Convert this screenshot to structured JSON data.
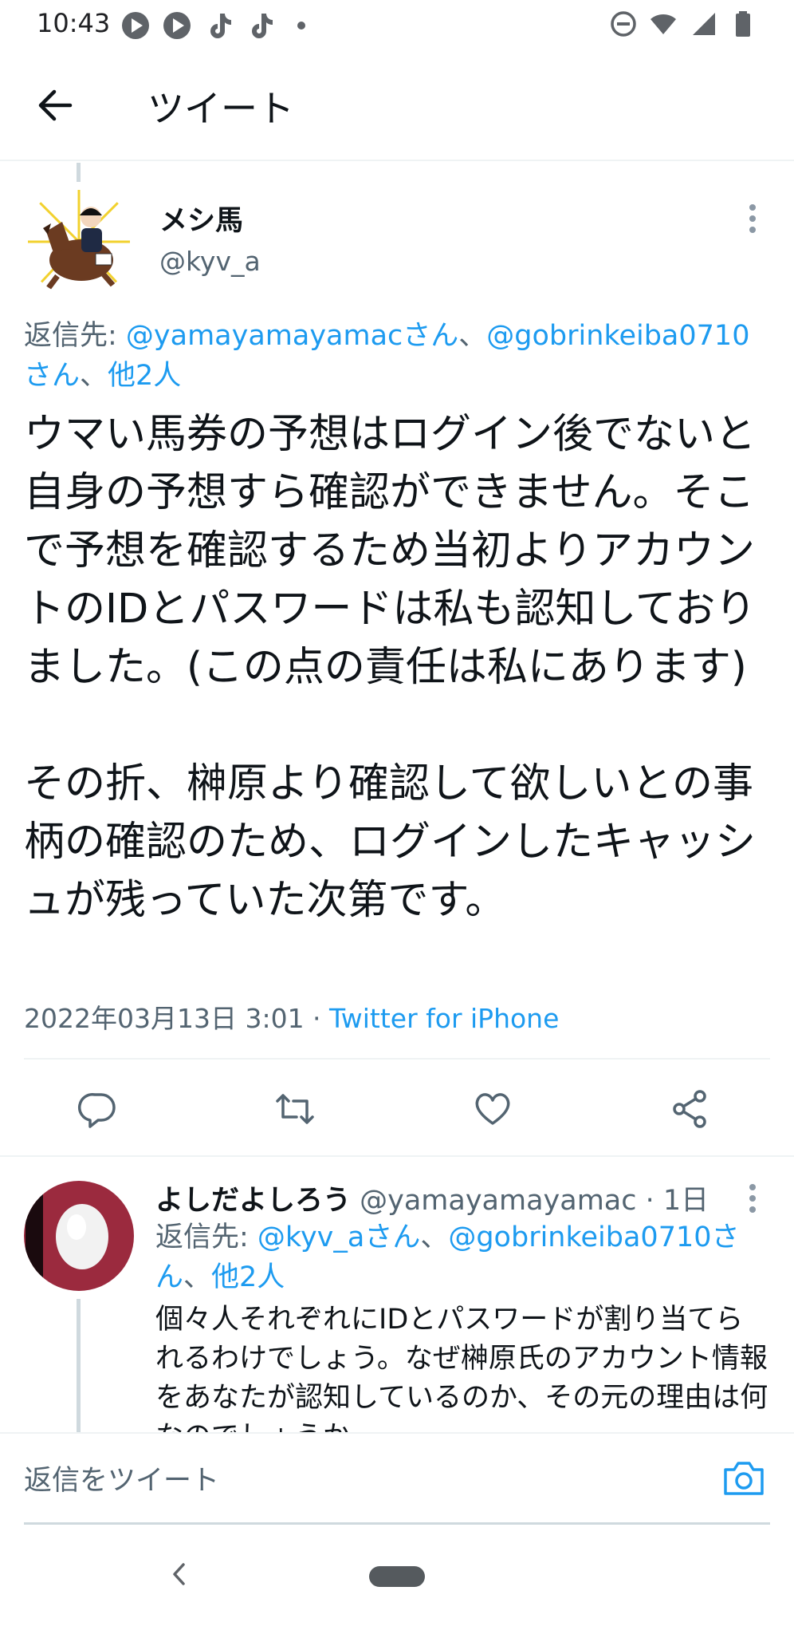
{
  "status_bar": {
    "time": "10:43",
    "app_icons": [
      "play-icon",
      "play-icon",
      "tiktok-icon",
      "tiktok-icon",
      "dot-icon"
    ],
    "system_icons": [
      "do-not-disturb-icon",
      "wifi-icon",
      "signal-icon",
      "battery-icon"
    ]
  },
  "header": {
    "title": "ツイート",
    "back_icon": "arrow-left-icon"
  },
  "tweet": {
    "author_name": "メシ馬",
    "author_handle": "@kyv_a",
    "reply_to_prefix": "返信先: ",
    "reply_to_mention_1": "@yamayamayamacさん",
    "reply_to_sep": "、",
    "reply_to_mention_2": "@gobrinkeiba0710さん",
    "reply_to_sep_2": "、",
    "reply_to_others": "他2人",
    "text": "ウマい馬券の予想はログイン後でないと自身の予想すら確認ができません。そこで予想を確認するため当初よりアカウントのIDとパスワードは私も認知しておりました。(この点の責任は私にあります)\n\nその折、榊原より確認して欲しいとの事柄の確認のため、ログインしたキャッシュが残っていた次第です。",
    "timestamp": "2022年03月13日 3:01",
    "meta_separator": " · ",
    "source": "Twitter for iPhone",
    "actions": [
      "reply-icon",
      "retweet-icon",
      "like-icon",
      "share-icon"
    ]
  },
  "reply": {
    "author_name": "よしだよしろう",
    "author_handle": " @yamayamayamac",
    "time_ago": " · 1日",
    "reply_to_prefix": "返信先: ",
    "reply_to_mention_1": "@kyv_aさん",
    "reply_to_sep": "、",
    "reply_to_mention_2": "@gobrinkeiba0710さん",
    "reply_to_sep_2": "、",
    "reply_to_others": "他2人",
    "text": "個々人それぞれにIDとパスワードが割り当てられるわけでしょう。なぜ榊原氏のアカウント情報をあなたが認知しているのか、その元の理由は何なのでしょうか"
  },
  "compose": {
    "placeholder": "返信をツイート",
    "camera_icon": "camera-icon"
  },
  "nav": {
    "back_icon": "chevron-left-icon",
    "home_icon": "home-pill-icon"
  },
  "colors": {
    "link": "#1d9bf0",
    "secondary_text": "#536471",
    "primary_text": "#0f1419",
    "divider": "#eff3f4",
    "reply_avatar_bg": "#9b2a3e"
  }
}
